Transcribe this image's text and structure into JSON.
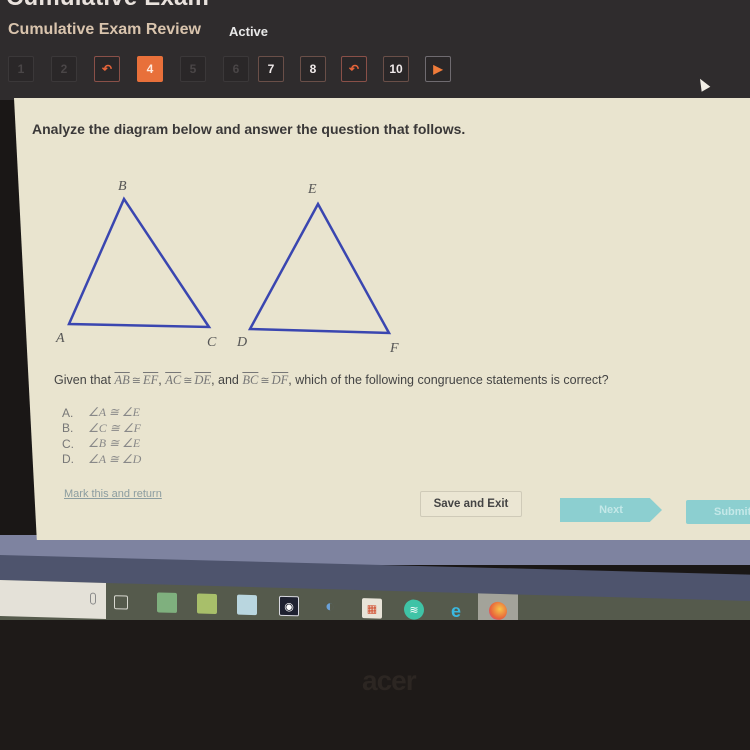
{
  "header": {
    "app_title": "Cumulative Exam",
    "exam_name": "Cumulative Exam Review",
    "status": "Active",
    "question_nav": [
      {
        "label": "1",
        "state": "dim"
      },
      {
        "label": "2",
        "state": "dim"
      },
      {
        "label": "↶",
        "state": "flagged",
        "icon": "flag-return-icon"
      },
      {
        "label": "4",
        "state": "current"
      },
      {
        "label": "5",
        "state": "dim"
      },
      {
        "label": "6",
        "state": "dim"
      },
      {
        "label": "7",
        "state": "normal"
      },
      {
        "label": "8",
        "state": "normal"
      },
      {
        "label": "↶",
        "state": "flagged",
        "icon": "flag-return-icon"
      },
      {
        "label": "10",
        "state": "normal"
      },
      {
        "label": "▶",
        "state": "next",
        "icon": "next-arrow-icon"
      }
    ]
  },
  "content": {
    "instructions": "Analyze the diagram below and answer the question that follows.",
    "diagram": {
      "triangle1_vertices": [
        "A",
        "B",
        "C"
      ],
      "triangle2_vertices": [
        "D",
        "E",
        "F"
      ],
      "stroke_color": "#3a46b0"
    },
    "question": {
      "prefix": "Given that",
      "seg1": "AB",
      "seg2": "EF",
      "seg3": "AC",
      "seg4": "DE",
      "and": ", and",
      "seg5": "BC",
      "seg6": "DF",
      "cong_symbol": "≅",
      "suffix": ", which of the following congruence statements is correct?"
    },
    "options": [
      {
        "letter": "A.",
        "text": "∠A ≅ ∠E"
      },
      {
        "letter": "B.",
        "text": "∠C ≅ ∠F"
      },
      {
        "letter": "C.",
        "text": "∠B ≅ ∠E"
      },
      {
        "letter": "D.",
        "text": "∠A ≅ ∠D"
      }
    ],
    "mark_link": "Mark this and return",
    "save_exit": "Save and Exit",
    "next": "Next",
    "submit": "Submit"
  },
  "taskbar": {
    "icons": [
      "microphone-icon",
      "task-view-icon",
      "app-icon",
      "cloud-app-icon",
      "file-explorer-icon",
      "media-app-icon",
      "game-launcher-icon",
      "store-icon",
      "spotify-icon",
      "edge-icon",
      "firefox-icon"
    ]
  },
  "bezel": {
    "brand": "acer"
  },
  "colors": {
    "accent_orange": "#e8703a",
    "panel_bg": "#e9e4cf",
    "teal_button": "#8ccfd0",
    "header_bg": "#2f2c2d"
  }
}
